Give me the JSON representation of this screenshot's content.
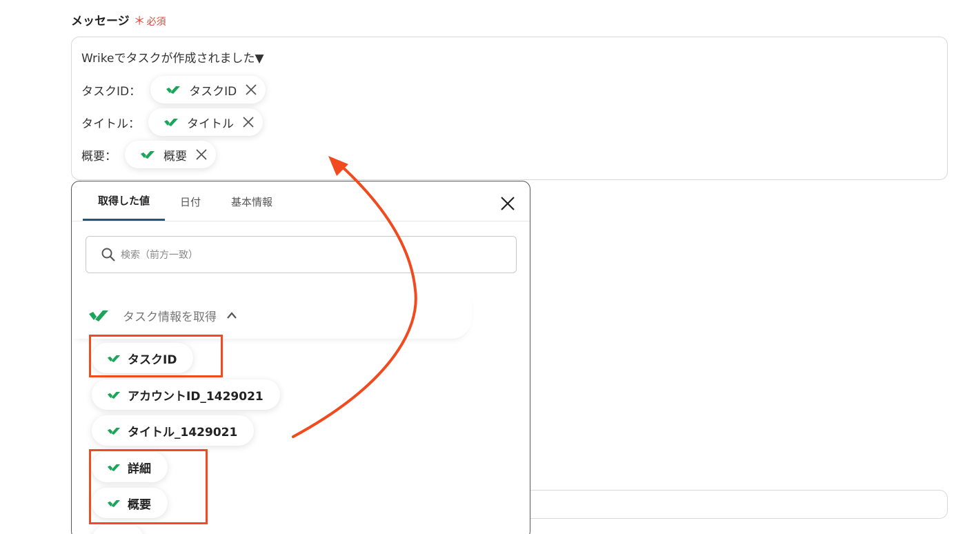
{
  "field": {
    "title": "メッセージ",
    "required_mark": "＊",
    "required_label": "必須"
  },
  "message": {
    "first_line": "Wrikeでタスクが作成されました▼",
    "rows": [
      {
        "label": "タスクID：",
        "chip": "タスクID"
      },
      {
        "label": "タイトル：",
        "chip": "タイトル"
      },
      {
        "label": "概要：",
        "chip": "概要"
      }
    ]
  },
  "panel": {
    "tabs": [
      "取得した値",
      "日付",
      "基本情報"
    ],
    "active_tab": 0,
    "search_placeholder": "検索（前方一致）",
    "group_label": "タスク情報を取得",
    "items": [
      "タスクID",
      "アカウントID_1429021",
      "タイトル_1429021",
      "詳細",
      "概要"
    ]
  },
  "colors": {
    "accent_tab": "#1e5a74",
    "highlight": "#f04a1e",
    "wrike_green": "#1aa55a",
    "required": "#e0463a"
  },
  "icons": {
    "wrike": "wrike-check-icon",
    "remove": "close-icon",
    "search": "search-icon",
    "collapse": "chevron-up-icon"
  }
}
